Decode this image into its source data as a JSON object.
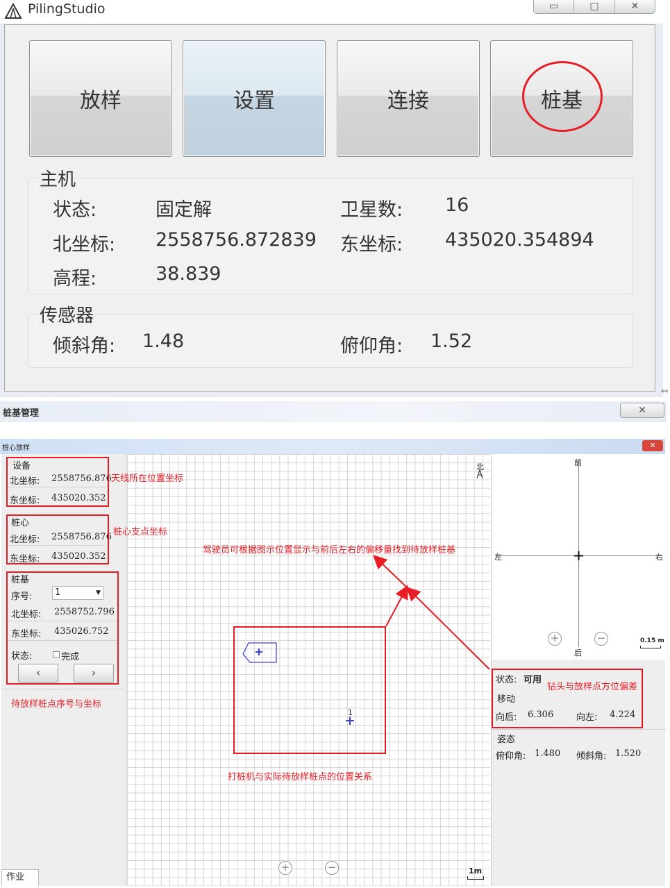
{
  "app": {
    "title": "PilingStudio",
    "window_controls": [
      "▭",
      "□",
      "✕"
    ]
  },
  "toolbar": {
    "buttons": [
      "放样",
      "设置",
      "连接",
      "桩基"
    ]
  },
  "host": {
    "group_title": "主机",
    "status_label": "状态:",
    "status_value": "固定解",
    "sat_label": "卫星数:",
    "sat_value": "16",
    "north_label": "北坐标:",
    "north_value": "2558756.872839",
    "east_label": "东坐标:",
    "east_value": "435020.354894",
    "elev_label": "高程:",
    "elev_value": "38.839"
  },
  "sensor": {
    "group_title": "传感器",
    "tilt_label": "倾斜角:",
    "tilt_value": "1.48",
    "pitch_label": "俯仰角:",
    "pitch_value": "1.52"
  },
  "pile_window": {
    "title": "桩基管理",
    "close": "✕"
  },
  "inner_window": {
    "title": "桩心放样",
    "close": "✕"
  },
  "device": {
    "title": "设备",
    "north_label": "北坐标:",
    "north_value": "2558756.876",
    "east_label": "东坐标:",
    "east_value": "435020.352"
  },
  "pile_center": {
    "title": "桩心",
    "north_label": "北坐标:",
    "north_value": "2558756.876",
    "east_label": "东坐标:",
    "east_value": "435020.352"
  },
  "pile_base": {
    "title": "桩基",
    "index_label": "序号:",
    "index_value": "1",
    "north_label": "北坐标:",
    "north_value": "2558752.796",
    "east_label": "东坐标:",
    "east_value": "435026.752",
    "status_label": "状态:",
    "done_label": "完成",
    "prev": "‹",
    "next": "›"
  },
  "annotations": {
    "antenna": "天线所在位置坐标",
    "pile_center": "桩心支点坐标",
    "driver_hint": "驾驶员可根据图示位置显示与前后左右的偏移量找到待放样桩基",
    "pending": "待放样桩点序号与坐标",
    "relation": "打桩机与实际待放样桩点的位置关系",
    "offset": "钻头与放样点方位偏差"
  },
  "map": {
    "north": "北",
    "pile_num": "1",
    "scale": "1m",
    "zoom_in": "+",
    "zoom_out": "−"
  },
  "compass": {
    "front": "前",
    "back": "后",
    "left": "左",
    "right": "右",
    "scale": "0.15 m",
    "zoom_in": "+",
    "zoom_out": "−"
  },
  "status": {
    "state_label": "状态:",
    "state_value": "可用",
    "move_title": "移动",
    "back_label": "向后:",
    "back_value": "6.306",
    "left_label": "向左:",
    "left_value": "4.224",
    "posture_title": "姿态",
    "pitch_label": "俯仰角:",
    "pitch_value": "1.480",
    "tilt_label": "倾斜角:",
    "tilt_value": "1.520"
  },
  "tabs": {
    "work": "作业"
  }
}
